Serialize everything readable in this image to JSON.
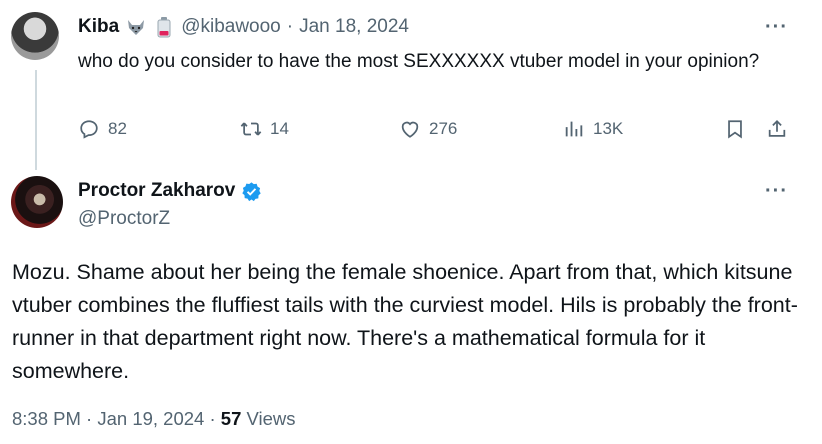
{
  "tweet1": {
    "display_name": "Kiba",
    "handle": "@kibawooo",
    "separator": "·",
    "date": "Jan 18, 2024",
    "text": "who do you consider to have the most SEXXXXXX vtuber model in your opinion?",
    "replies": "82",
    "retweets": "14",
    "likes": "276",
    "views": "13K",
    "badges": [
      "wolf-emoji",
      "battery-emoji"
    ]
  },
  "tweet2": {
    "display_name": "Proctor Zakharov",
    "handle": "@ProctorZ",
    "verified_color": "#1d9bf0",
    "text": "Mozu. Shame about her being the female shoenice. Apart from that, which kitsune vtuber combines the fluffiest tails with the curviest model. Hils is probably the front-runner in that department right now. There's a mathematical formula for it somewhere.",
    "time": "8:38 PM",
    "separator1": "·",
    "date": "Jan 19, 2024",
    "separator2": "·",
    "view_count": "57",
    "views_label": "Views"
  },
  "more_glyph": "···",
  "colors": {
    "text": "#0f1419",
    "muted": "#536471",
    "accent": "#1d9bf0",
    "thread_line": "#cfd9de"
  }
}
